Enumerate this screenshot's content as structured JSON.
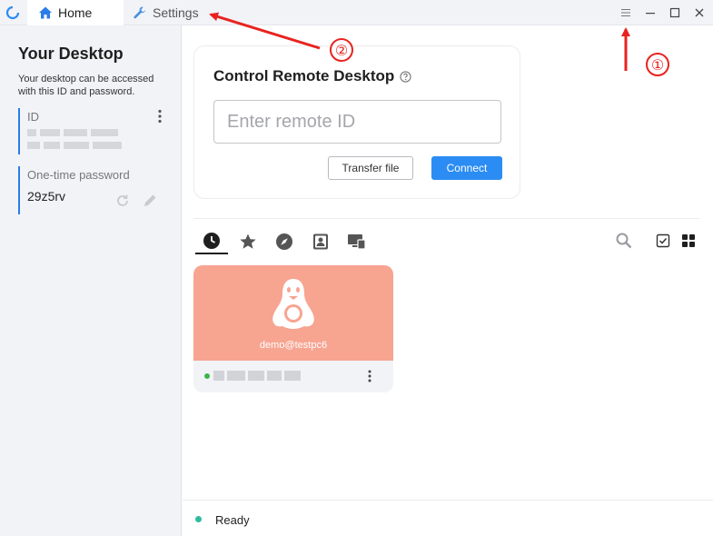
{
  "titlebar": {
    "tabs": [
      {
        "label": "Home",
        "icon": "home-icon"
      },
      {
        "label": "Settings",
        "icon": "wrench-icon"
      }
    ]
  },
  "sidebar": {
    "title": "Your Desktop",
    "description": "Your desktop can be accessed with this ID and password.",
    "id_label": "ID",
    "password_label": "One-time password",
    "password_value": "29z5rv"
  },
  "control": {
    "title": "Control Remote Desktop",
    "remote_id_placeholder": "Enter remote ID",
    "transfer_label": "Transfer file",
    "connect_label": "Connect"
  },
  "peer": {
    "name": "demo@testpc6",
    "status": "online"
  },
  "status": {
    "text": "Ready"
  },
  "annotations": [
    {
      "label": "①"
    },
    {
      "label": "②"
    }
  ],
  "colors": {
    "accent": "#2b8cf3",
    "peer_card": "#f7a491",
    "annotation": "#e8231f",
    "status_ok": "#2ebc9c"
  }
}
